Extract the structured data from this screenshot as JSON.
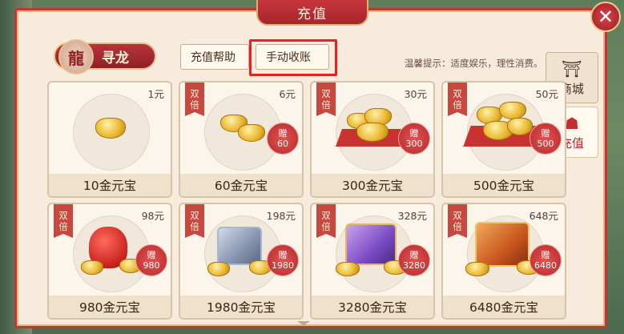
{
  "title": "充值",
  "close_icon": "close-icon",
  "channel": "寻龙",
  "tabs": [
    {
      "label": "充值帮助"
    },
    {
      "label": "手动收账"
    }
  ],
  "tip": "温馨提示：适度娱乐，理性消费。",
  "side_nav": [
    {
      "label": "商城",
      "icon": "shop-icon"
    },
    {
      "label": "充值",
      "icon": "recharge-icon"
    }
  ],
  "products": [
    {
      "price": "1元",
      "name": "10金元宝",
      "double": "",
      "bonus_label": "",
      "bonus": ""
    },
    {
      "price": "6元",
      "name": "60金元宝",
      "double": "双倍",
      "bonus_label": "赠",
      "bonus": "60"
    },
    {
      "price": "30元",
      "name": "300金元宝",
      "double": "双倍",
      "bonus_label": "赠",
      "bonus": "300"
    },
    {
      "price": "50元",
      "name": "500金元宝",
      "double": "双倍",
      "bonus_label": "赠",
      "bonus": "500"
    },
    {
      "price": "98元",
      "name": "980金元宝",
      "double": "双倍",
      "bonus_label": "赠",
      "bonus": "980"
    },
    {
      "price": "198元",
      "name": "1980金元宝",
      "double": "双倍",
      "bonus_label": "赠",
      "bonus": "1980"
    },
    {
      "price": "328元",
      "name": "3280金元宝",
      "double": "双倍",
      "bonus_label": "赠",
      "bonus": "3280"
    },
    {
      "price": "648元",
      "name": "6480金元宝",
      "double": "双倍",
      "bonus_label": "赠",
      "bonus": "6480"
    }
  ]
}
